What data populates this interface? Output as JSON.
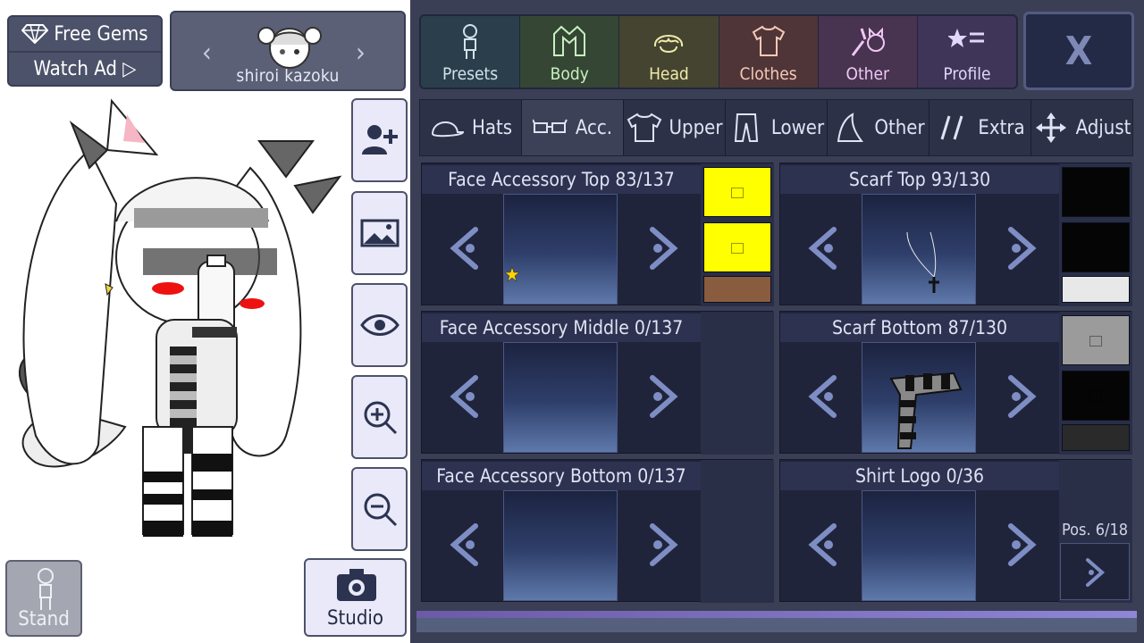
{
  "currency": {
    "free_gems_label": "Free Gems",
    "watch_ad_label": "Watch Ad ▷",
    "gem_icon": "diamond-icon"
  },
  "character": {
    "name": "shiroi kazoku",
    "prev_icon": "chevron-left-icon",
    "next_icon": "chevron-right-icon"
  },
  "side_tools": [
    {
      "name": "add-character-button",
      "icon": "add-user-icon"
    },
    {
      "name": "background-button",
      "icon": "image-icon"
    },
    {
      "name": "hide-ui-button",
      "icon": "eye-icon"
    },
    {
      "name": "zoom-in-button",
      "icon": "zoom-in-icon"
    },
    {
      "name": "zoom-out-button",
      "icon": "zoom-out-icon"
    }
  ],
  "bottom_left": {
    "stand_label": "Stand",
    "studio_label": "Studio"
  },
  "categories": [
    {
      "label": "Presets",
      "bg": "#2b3e4c",
      "color": "#cfe3ea"
    },
    {
      "label": "Body",
      "bg": "#354635",
      "color": "#c9f0bf"
    },
    {
      "label": "Head",
      "bg": "#444431",
      "color": "#f2eaa8"
    },
    {
      "label": "Clothes",
      "bg": "#4f3538",
      "color": "#f6c9b8"
    },
    {
      "label": "Other",
      "bg": "#483350",
      "color": "#efc7f5"
    },
    {
      "label": "Profile",
      "bg": "#3f3558",
      "color": "#e2d6fa"
    }
  ],
  "close_label": "X",
  "subtabs": [
    {
      "label": "Hats",
      "active": false
    },
    {
      "label": "Acc.",
      "active": true
    },
    {
      "label": "Upper",
      "active": false
    },
    {
      "label": "Lower",
      "active": false
    },
    {
      "label": "Other",
      "active": false
    },
    {
      "label": "Extra",
      "active": false
    },
    {
      "label": "Adjust",
      "active": false
    }
  ],
  "slots": [
    {
      "title": "Face Accessory Top 83/137",
      "swatches": [
        "#ffff00",
        "#ffff00",
        "#8a5c3f"
      ]
    },
    {
      "title": "Scarf Top 93/130",
      "swatches": [
        "#050505",
        "#050505",
        "#e8e8e8"
      ]
    },
    {
      "title": "Face Accessory Middle 0/137",
      "swatches": []
    },
    {
      "title": "Scarf Bottom 87/130",
      "swatches": [
        "#9b9b9b",
        "#050505",
        "#2a2a2a"
      ]
    },
    {
      "title": "Face Accessory Bottom 0/137",
      "swatches": []
    },
    {
      "title": "Shirt Logo 0/36",
      "swatches": []
    }
  ],
  "position": {
    "label": "Pos. 6/18"
  }
}
